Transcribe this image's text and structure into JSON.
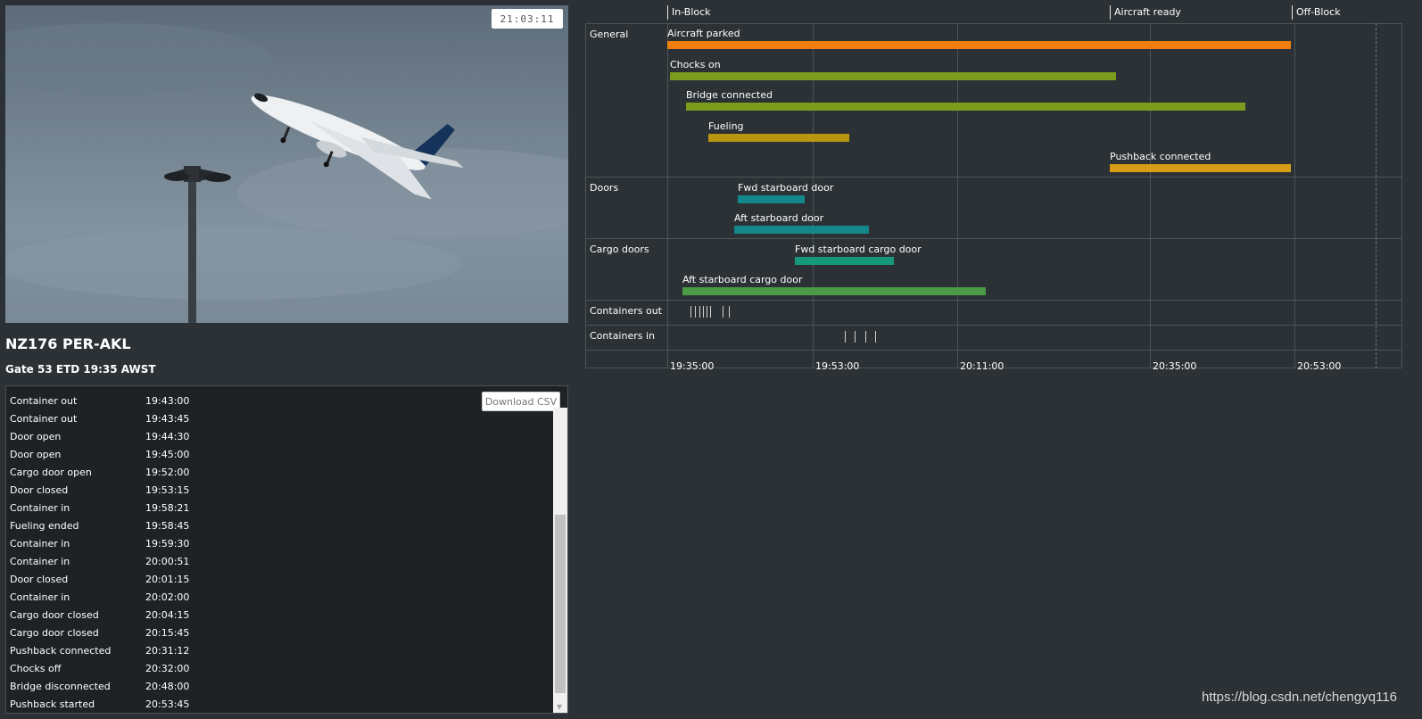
{
  "video": {
    "timestamp": "21:03:11"
  },
  "flight": {
    "title": "NZ176 PER-AKL",
    "subtitle": "Gate 53 ETD 19:35 AWST"
  },
  "log": {
    "download_label": "Download CSV",
    "rows": [
      {
        "event": "Container out",
        "time": "19:43:00"
      },
      {
        "event": "Container out",
        "time": "19:43:45"
      },
      {
        "event": "Door open",
        "time": "19:44:30"
      },
      {
        "event": "Door open",
        "time": "19:45:00"
      },
      {
        "event": "Cargo door open",
        "time": "19:52:00"
      },
      {
        "event": "Door closed",
        "time": "19:53:15"
      },
      {
        "event": "Container in",
        "time": "19:58:21"
      },
      {
        "event": "Fueling ended",
        "time": "19:58:45"
      },
      {
        "event": "Container in",
        "time": "19:59:30"
      },
      {
        "event": "Container in",
        "time": "20:00:51"
      },
      {
        "event": "Door closed",
        "time": "20:01:15"
      },
      {
        "event": "Container in",
        "time": "20:02:00"
      },
      {
        "event": "Cargo door closed",
        "time": "20:04:15"
      },
      {
        "event": "Cargo door closed",
        "time": "20:15:45"
      },
      {
        "event": "Pushback connected",
        "time": "20:31:12"
      },
      {
        "event": "Chocks off",
        "time": "20:32:00"
      },
      {
        "event": "Bridge disconnected",
        "time": "20:48:00"
      },
      {
        "event": "Pushback started",
        "time": "20:53:45"
      }
    ]
  },
  "gantt": {
    "milestones": [
      "In-Block",
      "Aircraft ready",
      "Off-Block"
    ],
    "categories": [
      "General",
      "Doors",
      "Cargo doors",
      "Containers out",
      "Containers in"
    ],
    "bars": [
      {
        "label": "Aircraft parked",
        "color": "#f07f0f"
      },
      {
        "label": "Chocks on",
        "color": "#7b9c1c"
      },
      {
        "label": "Bridge connected",
        "color": "#7b9c1c"
      },
      {
        "label": "Fueling",
        "color": "#b8960f"
      },
      {
        "label": "Pushback connected",
        "color": "#d79d17"
      },
      {
        "label": "Fwd starboard door",
        "color": "#14878a"
      },
      {
        "label": "Aft starboard door",
        "color": "#14878a"
      },
      {
        "label": "Fwd starboard cargo door",
        "color": "#17987a"
      },
      {
        "label": "Aft starboard cargo door",
        "color": "#4a9a46"
      }
    ],
    "ticks": [
      "19:35:00",
      "19:53:00",
      "20:11:00",
      "20:35:00",
      "20:53:00"
    ]
  },
  "watermark": "https://blog.csdn.net/chengyq116"
}
